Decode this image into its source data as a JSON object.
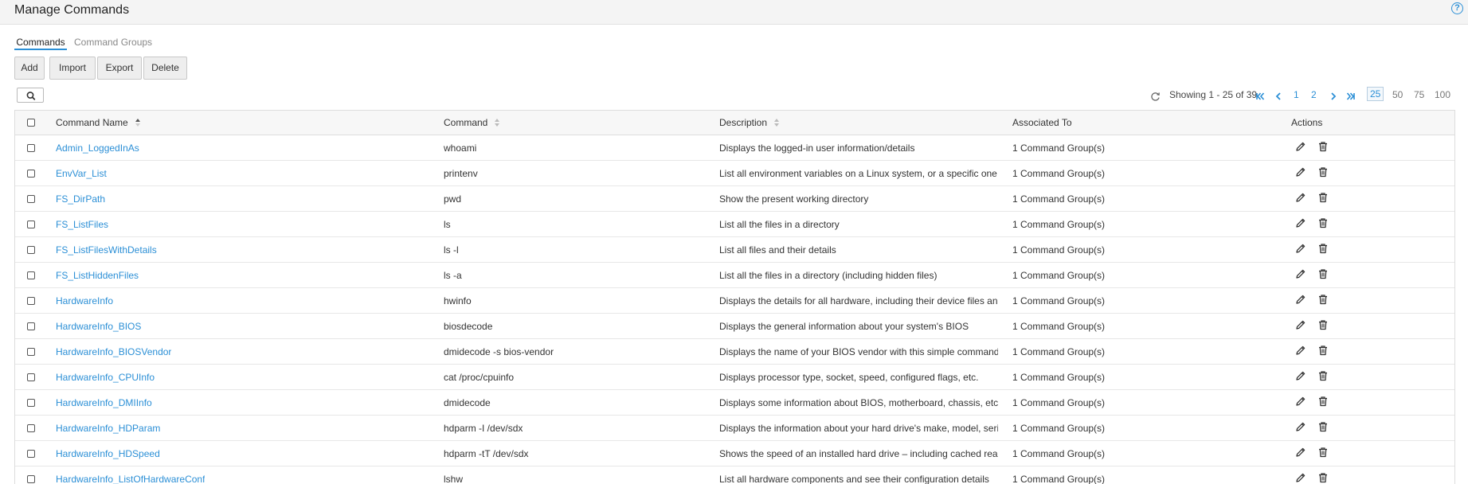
{
  "header": {
    "title": "Manage Commands",
    "help_icon": "?"
  },
  "tabs": [
    {
      "label": "Commands",
      "active": true
    },
    {
      "label": "Command Groups",
      "active": false
    }
  ],
  "toolbar": {
    "add": "Add",
    "import": "Import",
    "export": "Export",
    "delete": "Delete"
  },
  "pagination": {
    "showing": "Showing 1 - 25 of 39",
    "pages": [
      "1",
      "2"
    ],
    "page_sizes": [
      "25",
      "50",
      "75",
      "100"
    ],
    "selected_page_size": "25"
  },
  "table": {
    "columns": {
      "name": "Command Name",
      "command": "Command",
      "description": "Description",
      "associated": "Associated To",
      "actions": "Actions"
    },
    "rows": [
      {
        "name": "Admin_LoggedInAs",
        "command": "whoami",
        "description": "Displays the logged-in user information/details",
        "associated": "1 Command Group(s)"
      },
      {
        "name": "EnvVar_List",
        "command": "printenv",
        "description": "List all environment variables on a Linux system, or a specific one",
        "associated": "1 Command Group(s)"
      },
      {
        "name": "FS_DirPath",
        "command": "pwd",
        "description": "Show the present working directory",
        "associated": "1 Command Group(s)"
      },
      {
        "name": "FS_ListFiles",
        "command": "ls",
        "description": "List all the files in a directory",
        "associated": "1 Command Group(s)"
      },
      {
        "name": "FS_ListFilesWithDetails",
        "command": "ls -l",
        "description": "List all files and their details",
        "associated": "1 Command Group(s)"
      },
      {
        "name": "FS_ListHiddenFiles",
        "command": "ls -a",
        "description": "List all the files in a directory (including hidden files)",
        "associated": "1 Command Group(s)"
      },
      {
        "name": "HardwareInfo",
        "command": "hwinfo",
        "description": "Displays the details for all hardware, including their device files and ...",
        "associated": "1 Command Group(s)"
      },
      {
        "name": "HardwareInfo_BIOS",
        "command": "biosdecode",
        "description": "Displays the general information about your system's BIOS",
        "associated": "1 Command Group(s)"
      },
      {
        "name": "HardwareInfo_BIOSVendor",
        "command": "dmidecode -s bios-vendor",
        "description": "Displays the name of your BIOS vendor with this simple command",
        "associated": "1 Command Group(s)"
      },
      {
        "name": "HardwareInfo_CPUInfo",
        "command": "cat /proc/cpuinfo",
        "description": "Displays processor type, socket, speed, configured flags, etc.",
        "associated": "1 Command Group(s)"
      },
      {
        "name": "HardwareInfo_DMIInfo",
        "command": "dmidecode",
        "description": "Displays some information about BIOS, motherboard, chassis, etc.",
        "associated": "1 Command Group(s)"
      },
      {
        "name": "HardwareInfo_HDParam",
        "command": "hdparm -I /dev/sdx",
        "description": "Displays the information about your hard drive's make, model, seria...",
        "associated": "1 Command Group(s)"
      },
      {
        "name": "HardwareInfo_HDSpeed",
        "command": "hdparm -tT /dev/sdx",
        "description": "Shows the speed of an installed hard drive – including cached reads...",
        "associated": "1 Command Group(s)"
      },
      {
        "name": "HardwareInfo_ListOfHardwareConf",
        "command": "lshw",
        "description": "List all hardware components and see their configuration details",
        "associated": "1 Command Group(s)"
      }
    ]
  },
  "colors": {
    "accent": "#2b8fd6",
    "header_bg": "#f4f4f4",
    "table_header_bg": "#f7f7f7"
  },
  "icons": {
    "search": "search-icon",
    "refresh": "refresh-icon",
    "first": "first-page-icon",
    "prev": "previous-page-icon",
    "next": "next-page-icon",
    "last": "last-page-icon",
    "edit": "edit-icon",
    "delete": "delete-icon",
    "sort": "sort-icon"
  }
}
